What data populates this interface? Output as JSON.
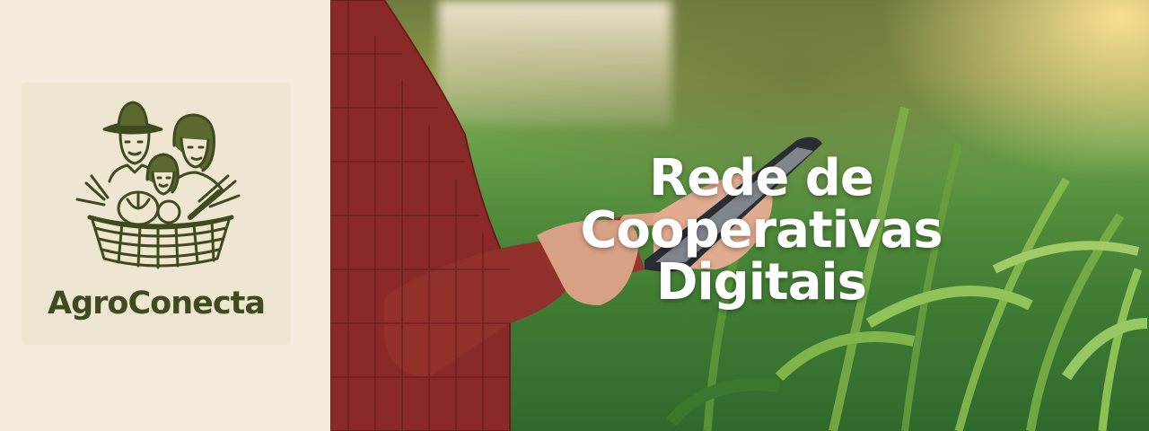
{
  "brand": {
    "name": "AgroConecta",
    "logo_icon": "farmer-family-basket-icon"
  },
  "hero": {
    "headline_line1": "Rede de Cooperativas",
    "headline_line2": "Digitais",
    "photo_icon": "farmer-phone-field-photo"
  },
  "colors": {
    "brand_text": "#3e4a1f",
    "panel_bg": "#f4ecdc",
    "headline": "#ffffff"
  }
}
